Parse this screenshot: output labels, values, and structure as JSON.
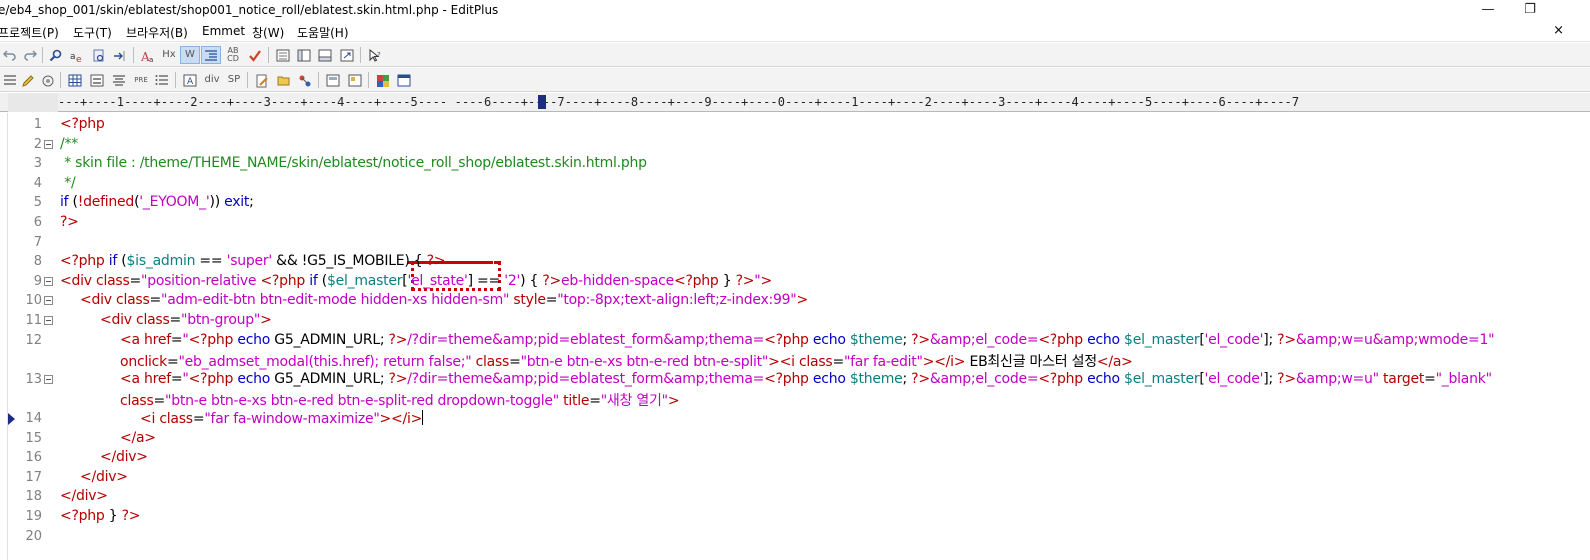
{
  "window": {
    "title": "e/eb4_shop_001/skin/eblatest/shop001_notice_roll/eblatest.skin.html.php - EditPlus",
    "minimize": "—",
    "restore": "❐"
  },
  "menu": {
    "items": [
      "프로젝트(P)",
      "도구(T)",
      "브라우저(B)",
      "Emmet",
      "창(W)",
      "도움말(H)"
    ],
    "close": "×"
  },
  "toolbar1": {
    "labels": {
      "hx": "Hx",
      "w": "W",
      "abcd": "AB CD"
    }
  },
  "toolbar2": {
    "labels": {
      "pre": "PRE",
      "div": "div",
      "sp": "SP"
    }
  },
  "ruler": {
    "text": "---+----1----+----2----+----3----+----4----+----5---- ----6----+----7----+----8----+----9----+----0----+----1----+----2----+----3----+----4----+----5----+----6----+----7"
  },
  "colors": {
    "tag": "#b40000",
    "comment": "#1f8a1f",
    "keyword": "#0000c8",
    "string": "#c000c0",
    "variable": "#0a7f80",
    "annotation": "#cc0000"
  },
  "code_lines": [
    {
      "n": "1",
      "fold": false,
      "indent": 0,
      "segs": [
        [
          "c-red",
          "<?php"
        ]
      ]
    },
    {
      "n": "2",
      "fold": true,
      "indent": 0,
      "segs": [
        [
          "c-green",
          "/**"
        ]
      ]
    },
    {
      "n": "3",
      "fold": false,
      "indent": 0,
      "segs": [
        [
          "c-green",
          " * skin file : /theme/THEME_NAME/skin/eblatest/notice_roll_shop/eblatest.skin.html.php"
        ]
      ]
    },
    {
      "n": "4",
      "fold": false,
      "indent": 0,
      "segs": [
        [
          "c-green",
          " */"
        ]
      ]
    },
    {
      "n": "5",
      "fold": false,
      "indent": 0,
      "segs": [
        [
          "c-blue",
          "if"
        ],
        [
          "c-black",
          " ("
        ],
        [
          "c-red",
          "!defined"
        ],
        [
          "c-black",
          "("
        ],
        [
          "c-mag",
          "'_EYOOM_'"
        ],
        [
          "c-black",
          ")) "
        ],
        [
          "c-blue",
          "exit"
        ],
        [
          "c-black",
          ";"
        ]
      ]
    },
    {
      "n": "6",
      "fold": false,
      "indent": 0,
      "segs": [
        [
          "c-red",
          "?>"
        ]
      ]
    },
    {
      "n": "7",
      "fold": false,
      "indent": 0,
      "segs": []
    },
    {
      "n": "8",
      "fold": false,
      "indent": 0,
      "segs": [
        [
          "c-red",
          "<?php"
        ],
        [
          "c-black",
          " "
        ],
        [
          "c-blue",
          "if"
        ],
        [
          "c-black",
          " ("
        ],
        [
          "c-teal",
          "$is_admin"
        ],
        [
          "c-black",
          " == "
        ],
        [
          "c-mag",
          "'super'"
        ],
        [
          "c-black",
          " && !"
        ],
        [
          "c-black",
          "G5_IS_MOBILE"
        ],
        [
          "c-black",
          ") { "
        ],
        [
          "c-red",
          "?>"
        ]
      ]
    },
    {
      "n": "9",
      "fold": true,
      "indent": 0,
      "segs": [
        [
          "c-red",
          "<div"
        ],
        [
          "c-black",
          " "
        ],
        [
          "c-red",
          "class"
        ],
        [
          "c-black",
          "="
        ],
        [
          "c-mag",
          "\"position-relative "
        ],
        [
          "c-red",
          "<?php"
        ],
        [
          "c-black",
          " "
        ],
        [
          "c-blue",
          "if"
        ],
        [
          "c-black",
          " ("
        ],
        [
          "c-teal",
          "$el_master"
        ],
        [
          "c-black",
          "["
        ],
        [
          "c-mag",
          "'el_state'"
        ],
        [
          "c-black",
          "] == "
        ],
        [
          "c-mag",
          "'2'"
        ],
        [
          "c-black",
          ") { "
        ],
        [
          "c-red",
          "?>"
        ],
        [
          "c-mag",
          "eb-hidden-space"
        ],
        [
          "c-red",
          "<?php"
        ],
        [
          "c-black",
          " } "
        ],
        [
          "c-red",
          "?>"
        ],
        [
          "c-mag",
          "\""
        ],
        [
          "c-red",
          ">"
        ]
      ]
    },
    {
      "n": "10",
      "fold": true,
      "indent": 1,
      "segs": [
        [
          "c-red",
          "<div"
        ],
        [
          "c-black",
          " "
        ],
        [
          "c-red",
          "class"
        ],
        [
          "c-black",
          "="
        ],
        [
          "c-mag",
          "\"adm-edit-btn btn-edit-mode hidden-xs hidden-sm\""
        ],
        [
          "c-black",
          " "
        ],
        [
          "c-red",
          "style"
        ],
        [
          "c-black",
          "="
        ],
        [
          "c-mag",
          "\"top:-8px;text-align:left;z-index:99\""
        ],
        [
          "c-red",
          ">"
        ]
      ]
    },
    {
      "n": "11",
      "fold": true,
      "indent": 2,
      "segs": [
        [
          "c-red",
          "<div"
        ],
        [
          "c-black",
          " "
        ],
        [
          "c-red",
          "class"
        ],
        [
          "c-black",
          "="
        ],
        [
          "c-mag",
          "\"btn-group\""
        ],
        [
          "c-red",
          ">"
        ]
      ]
    },
    {
      "n": "12",
      "fold": false,
      "indent": 3,
      "segs": [
        [
          "c-red",
          "<a"
        ],
        [
          "c-black",
          " "
        ],
        [
          "c-red",
          "href"
        ],
        [
          "c-black",
          "="
        ],
        [
          "c-mag",
          "\""
        ],
        [
          "c-red",
          "<?php"
        ],
        [
          "c-black",
          " "
        ],
        [
          "c-blue",
          "echo"
        ],
        [
          "c-black",
          " G5_ADMIN_URL; "
        ],
        [
          "c-red",
          "?>"
        ],
        [
          "c-mag",
          "/?dir=theme&amp;pid=eblatest_form&amp;thema="
        ],
        [
          "c-red",
          "<?php"
        ],
        [
          "c-black",
          " "
        ],
        [
          "c-blue",
          "echo"
        ],
        [
          "c-black",
          " "
        ],
        [
          "c-teal",
          "$theme"
        ],
        [
          "c-black",
          "; "
        ],
        [
          "c-red",
          "?>"
        ],
        [
          "c-mag",
          "&amp;el_code="
        ],
        [
          "c-red",
          "<?php"
        ],
        [
          "c-black",
          " "
        ],
        [
          "c-blue",
          "echo"
        ],
        [
          "c-black",
          " "
        ],
        [
          "c-teal",
          "$el_master"
        ],
        [
          "c-black",
          "["
        ],
        [
          "c-mag",
          "'el_code'"
        ],
        [
          "c-black",
          "]; "
        ],
        [
          "c-red",
          "?>"
        ],
        [
          "c-mag",
          "&amp;w=u&amp;wmode=1\""
        ]
      ]
    },
    {
      "n": "",
      "fold": false,
      "indent": 3,
      "segs": [
        [
          "c-red",
          "onclick"
        ],
        [
          "c-black",
          "="
        ],
        [
          "c-mag",
          "\"eb_admset_modal(this.href); return false;\""
        ],
        [
          "c-black",
          " "
        ],
        [
          "c-red",
          "class"
        ],
        [
          "c-black",
          "="
        ],
        [
          "c-mag",
          "\"btn-e btn-e-xs btn-e-red btn-e-split\""
        ],
        [
          "c-red",
          "><i"
        ],
        [
          "c-black",
          " "
        ],
        [
          "c-red",
          "class"
        ],
        [
          "c-black",
          "="
        ],
        [
          "c-mag",
          "\"far fa-edit\""
        ],
        [
          "c-red",
          "></i>"
        ],
        [
          "c-black",
          " EB최신글 마스터 설정"
        ],
        [
          "c-red",
          "</a>"
        ]
      ]
    },
    {
      "n": "13",
      "fold": true,
      "indent": 3,
      "segs": [
        [
          "c-red",
          "<a"
        ],
        [
          "c-black",
          " "
        ],
        [
          "c-red",
          "href"
        ],
        [
          "c-black",
          "="
        ],
        [
          "c-mag",
          "\""
        ],
        [
          "c-red",
          "<?php"
        ],
        [
          "c-black",
          " "
        ],
        [
          "c-blue",
          "echo"
        ],
        [
          "c-black",
          " G5_ADMIN_URL; "
        ],
        [
          "c-red",
          "?>"
        ],
        [
          "c-mag",
          "/?dir=theme&amp;pid=eblatest_form&amp;thema="
        ],
        [
          "c-red",
          "<?php"
        ],
        [
          "c-black",
          " "
        ],
        [
          "c-blue",
          "echo"
        ],
        [
          "c-black",
          " "
        ],
        [
          "c-teal",
          "$theme"
        ],
        [
          "c-black",
          "; "
        ],
        [
          "c-red",
          "?>"
        ],
        [
          "c-mag",
          "&amp;el_code="
        ],
        [
          "c-red",
          "<?php"
        ],
        [
          "c-black",
          " "
        ],
        [
          "c-blue",
          "echo"
        ],
        [
          "c-black",
          " "
        ],
        [
          "c-teal",
          "$el_master"
        ],
        [
          "c-black",
          "["
        ],
        [
          "c-mag",
          "'el_code'"
        ],
        [
          "c-black",
          "]; "
        ],
        [
          "c-red",
          "?>"
        ],
        [
          "c-mag",
          "&amp;w=u\""
        ],
        [
          "c-black",
          " "
        ],
        [
          "c-red",
          "target"
        ],
        [
          "c-black",
          "="
        ],
        [
          "c-mag",
          "\"_blank\""
        ]
      ]
    },
    {
      "n": "",
      "fold": false,
      "indent": 3,
      "segs": [
        [
          "c-red",
          "class"
        ],
        [
          "c-black",
          "="
        ],
        [
          "c-mag",
          "\"btn-e btn-e-xs btn-e-red btn-e-split-red dropdown-toggle\""
        ],
        [
          "c-black",
          " "
        ],
        [
          "c-red",
          "title"
        ],
        [
          "c-black",
          "="
        ],
        [
          "c-mag",
          "\"새창 열기\""
        ],
        [
          "c-red",
          ">"
        ]
      ]
    },
    {
      "n": "14",
      "fold": false,
      "indent": 4,
      "bookmark": true,
      "caret": true,
      "segs": [
        [
          "c-red",
          "<i"
        ],
        [
          "c-black",
          " "
        ],
        [
          "c-red",
          "class"
        ],
        [
          "c-black",
          "="
        ],
        [
          "c-mag",
          "\"far fa-window-maximize\""
        ],
        [
          "c-red",
          "></i>"
        ]
      ]
    },
    {
      "n": "15",
      "fold": false,
      "indent": 3,
      "segs": [
        [
          "c-red",
          "</a>"
        ]
      ]
    },
    {
      "n": "16",
      "fold": false,
      "indent": 2,
      "segs": [
        [
          "c-red",
          "</div>"
        ]
      ]
    },
    {
      "n": "17",
      "fold": false,
      "indent": 1,
      "segs": [
        [
          "c-red",
          "</div>"
        ]
      ]
    },
    {
      "n": "18",
      "fold": false,
      "indent": 0,
      "segs": [
        [
          "c-red",
          "</div>"
        ]
      ]
    },
    {
      "n": "19",
      "fold": false,
      "indent": 0,
      "segs": [
        [
          "c-red",
          "<?php"
        ],
        [
          "c-black",
          " } "
        ],
        [
          "c-red",
          "?>"
        ]
      ]
    },
    {
      "n": "20",
      "fold": false,
      "indent": 0,
      "segs": []
    }
  ]
}
